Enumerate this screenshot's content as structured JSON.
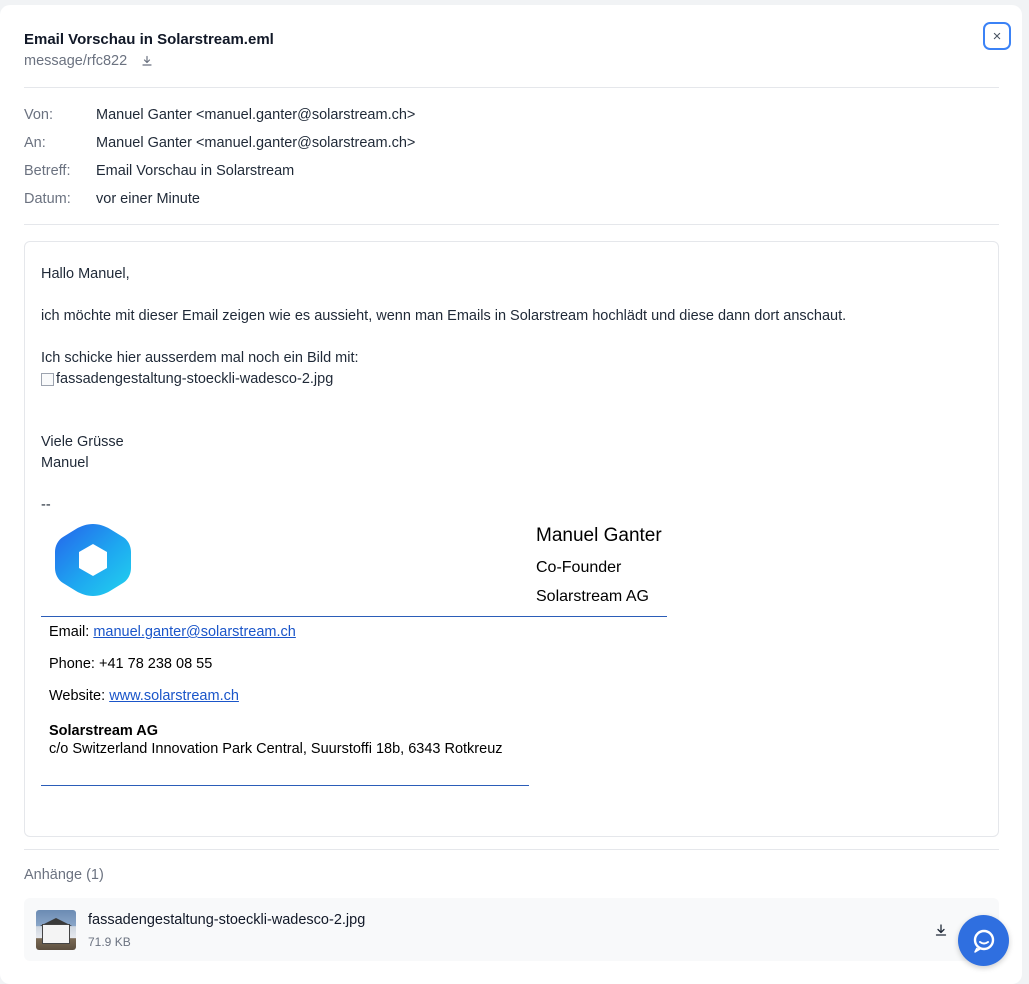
{
  "header": {
    "title": "Email Vorschau in Solarstream.eml",
    "mime_type": "message/rfc822",
    "close_label": "×"
  },
  "meta": [
    {
      "label": "Von:",
      "value": "Manuel Ganter <manuel.ganter@solarstream.ch>"
    },
    {
      "label": "An:",
      "value": "Manuel Ganter <manuel.ganter@solarstream.ch>"
    },
    {
      "label": "Betreff:",
      "value": "Email Vorschau in Solarstream"
    },
    {
      "label": "Datum:",
      "value": "vor einer Minute"
    }
  ],
  "body": {
    "greeting": "Hallo Manuel,",
    "paragraph": "ich möchte mit dieser Email zeigen wie es aussieht, wenn man Emails in Solarstream hochlädt und diese dann dort anschaut.",
    "image_intro": "Ich schicke hier ausserdem mal noch ein Bild mit:",
    "image_alt": "fassadengestaltung-stoeckli-wadesco-2.jpg",
    "closing_1": "Viele Grüsse",
    "closing_2": "Manuel",
    "sig_sep": "--"
  },
  "signature": {
    "name": "Manuel Ganter",
    "role": "Co-Founder",
    "company": "Solarstream AG",
    "email_label": "Email:",
    "email": "manuel.ganter@solarstream.ch",
    "phone_label": "Phone:",
    "phone": "+41 78 238 08 55",
    "website_label": "Website:",
    "website": "www.solarstream.ch",
    "company_bold": "Solarstream AG",
    "address": "c/o Switzerland Innovation Park Central, Suurstoffi 18b, 6343 Rotkreuz"
  },
  "attachments": {
    "title": "Anhänge (1)",
    "items": [
      {
        "name": "fassadengestaltung-stoeckli-wadesco-2.jpg",
        "size": "71.9 KB"
      }
    ]
  },
  "colors": {
    "accent": "#3b82f6",
    "link": "#1a55c9",
    "signature_rule": "#2b5db8",
    "chat_button": "#2f6fe0"
  },
  "icons": {
    "close": "close-icon",
    "download": "download-icon",
    "chat": "chat-icon",
    "logo": "solarstream-logo"
  }
}
